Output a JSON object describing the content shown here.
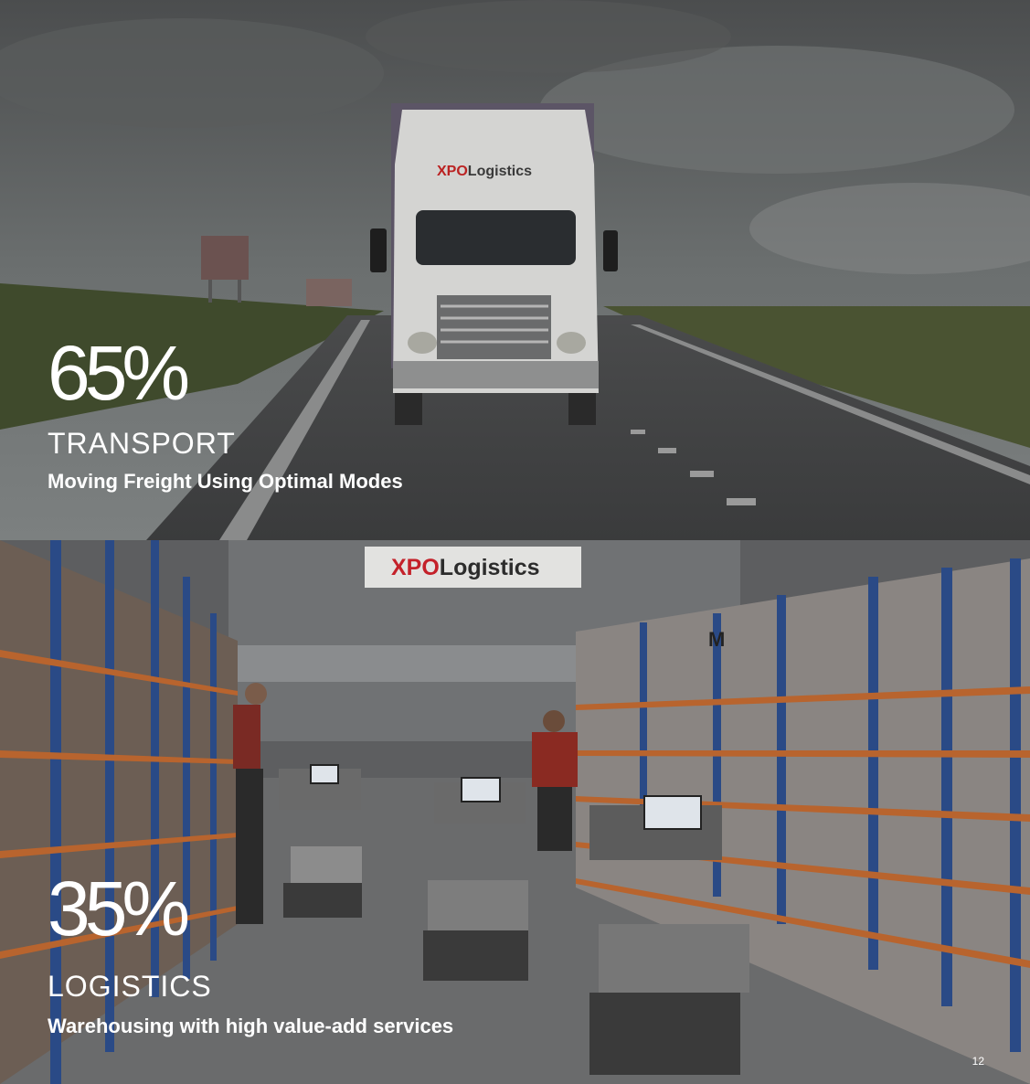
{
  "top": {
    "stat": "65%",
    "category": "TRANSPORT",
    "subtitle": "Moving Freight Using Optimal Modes",
    "truck_brand_red": "XPO",
    "truck_brand_dark": "Logistics"
  },
  "bottom": {
    "stat": "35%",
    "category": "LOGISTICS",
    "subtitle": "Warehousing with high value-add services",
    "banner_red": "XPO",
    "banner_dark": "Logistics",
    "sign_letter": "M"
  },
  "page_number": "12",
  "colors": {
    "brand_red": "#d1202b",
    "overlay": "#1e2024",
    "shelf_blue": "#2a4a86",
    "shelf_orange": "#b8642e"
  }
}
